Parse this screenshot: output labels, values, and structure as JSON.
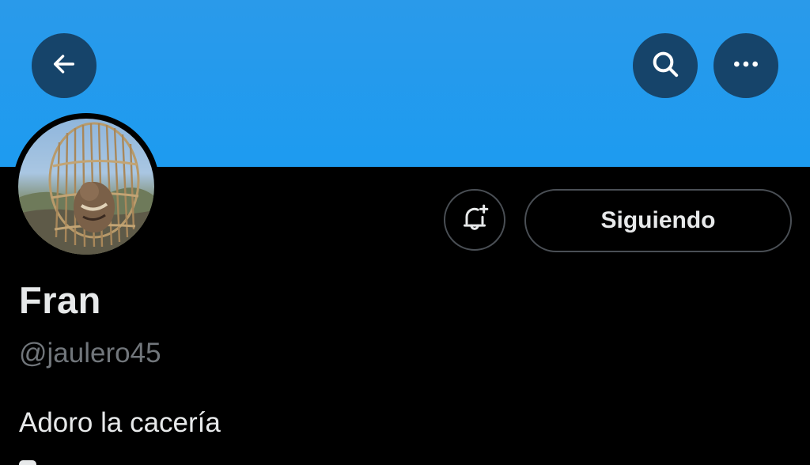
{
  "header": {
    "back_icon": "arrow-left-icon",
    "search_icon": "search-icon",
    "more_icon": "more-horizontal-icon",
    "banner_color": "#1d9bf0",
    "button_color": "#16446a"
  },
  "profile": {
    "avatar_alt": "caged bird avatar",
    "display_name": "Fran",
    "handle": "@jaulero45",
    "bio": "Adoro la cacería"
  },
  "actions": {
    "notify_icon": "bell-plus-icon",
    "following_label": "Siguiendo"
  }
}
